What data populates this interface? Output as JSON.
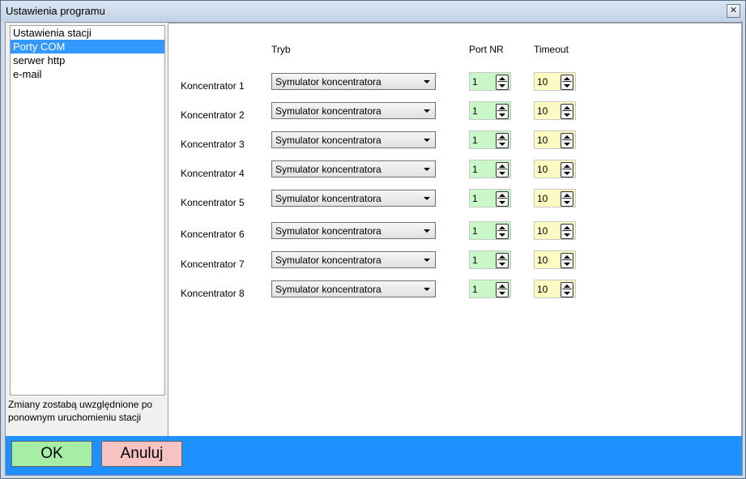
{
  "window": {
    "title": "Ustawienia programu",
    "close_glyph": "✕"
  },
  "nav": {
    "items": [
      {
        "label": "Ustawienia stacji",
        "selected": false
      },
      {
        "label": "Porty COM",
        "selected": true
      },
      {
        "label": "serwer http",
        "selected": false
      },
      {
        "label": "e-mail",
        "selected": false
      }
    ],
    "note": "Zmiany zostabą uwzględnione po ponownym uruchomieniu stacji"
  },
  "table": {
    "headers": {
      "mode": "Tryb",
      "port": "Port NR",
      "timeout": "Timeout"
    },
    "rows": [
      {
        "label": "Koncentrator 1",
        "mode": "Symulator koncentratora",
        "port": "1",
        "timeout": "10"
      },
      {
        "label": "Koncentrator 2",
        "mode": "Symulator koncentratora",
        "port": "1",
        "timeout": "10"
      },
      {
        "label": "Koncentrator 3",
        "mode": "Symulator koncentratora",
        "port": "1",
        "timeout": "10"
      },
      {
        "label": "Koncentrator 4",
        "mode": "Symulator koncentratora",
        "port": "1",
        "timeout": "10"
      },
      {
        "label": "Koncentrator 5",
        "mode": "Symulator koncentratora",
        "port": "1",
        "timeout": "10"
      },
      {
        "label": "Koncentrator 6",
        "mode": "Symulator koncentratora",
        "port": "1",
        "timeout": "10"
      },
      {
        "label": "Koncentrator 7",
        "mode": "Symulator koncentratora",
        "port": "1",
        "timeout": "10"
      },
      {
        "label": "Koncentrator 8",
        "mode": "Symulator koncentratora",
        "port": "1",
        "timeout": "10"
      }
    ]
  },
  "buttons": {
    "ok": "OK",
    "cancel": "Anuluj"
  },
  "colors": {
    "selection": "#3399ff",
    "port_field": "#c8f7c8",
    "timeout_field": "#fbfbc2",
    "bottom_bar": "#1e90ff",
    "ok_button": "#a6eea6",
    "cancel_button": "#f7c2c2"
  }
}
